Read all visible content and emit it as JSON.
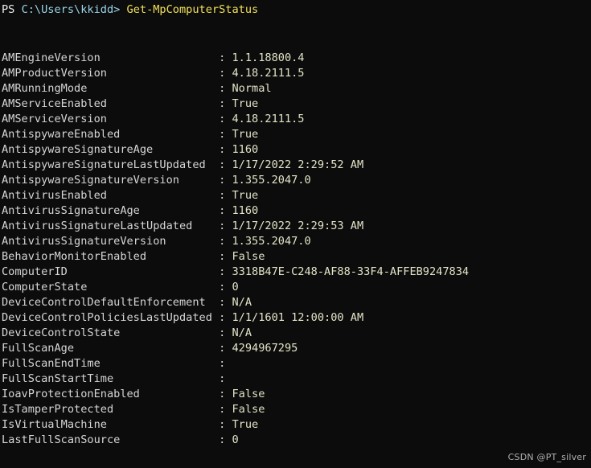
{
  "terminal": {
    "background_color": "#0c0c0c",
    "prompt": {
      "shell_label": "PS",
      "path": "C:\\Users\\kkidd>",
      "command": "Get-MpComputerStatus",
      "prompt_color": "#9ad4e8",
      "command_color": "#f2e05a"
    },
    "name_column_width": 33,
    "output_rows": [
      {
        "name": "AMEngineVersion",
        "value": "1.1.18800.4"
      },
      {
        "name": "AMProductVersion",
        "value": "4.18.2111.5"
      },
      {
        "name": "AMRunningMode",
        "value": "Normal"
      },
      {
        "name": "AMServiceEnabled",
        "value": "True"
      },
      {
        "name": "AMServiceVersion",
        "value": "4.18.2111.5"
      },
      {
        "name": "AntispywareEnabled",
        "value": "True"
      },
      {
        "name": "AntispywareSignatureAge",
        "value": "1160"
      },
      {
        "name": "AntispywareSignatureLastUpdated",
        "value": "1/17/2022 2:29:52 AM"
      },
      {
        "name": "AntispywareSignatureVersion",
        "value": "1.355.2047.0"
      },
      {
        "name": "AntivirusEnabled",
        "value": "True"
      },
      {
        "name": "AntivirusSignatureAge",
        "value": "1160"
      },
      {
        "name": "AntivirusSignatureLastUpdated",
        "value": "1/17/2022 2:29:53 AM"
      },
      {
        "name": "AntivirusSignatureVersion",
        "value": "1.355.2047.0"
      },
      {
        "name": "BehaviorMonitorEnabled",
        "value": "False"
      },
      {
        "name": "ComputerID",
        "value": "3318B47E-C248-AF88-33F4-AFFEB9247834"
      },
      {
        "name": "ComputerState",
        "value": "0"
      },
      {
        "name": "DeviceControlDefaultEnforcement",
        "value": "N/A"
      },
      {
        "name": "DeviceControlPoliciesLastUpdated",
        "value": "1/1/1601 12:00:00 AM"
      },
      {
        "name": "DeviceControlState",
        "value": "N/A"
      },
      {
        "name": "FullScanAge",
        "value": "4294967295"
      },
      {
        "name": "FullScanEndTime",
        "value": ""
      },
      {
        "name": "FullScanStartTime",
        "value": ""
      },
      {
        "name": "IoavProtectionEnabled",
        "value": "False"
      },
      {
        "name": "IsTamperProtected",
        "value": "False"
      },
      {
        "name": "IsVirtualMachine",
        "value": "True"
      },
      {
        "name": "LastFullScanSource",
        "value": "0"
      }
    ]
  },
  "watermark": {
    "text": "CSDN @PT_silver"
  }
}
